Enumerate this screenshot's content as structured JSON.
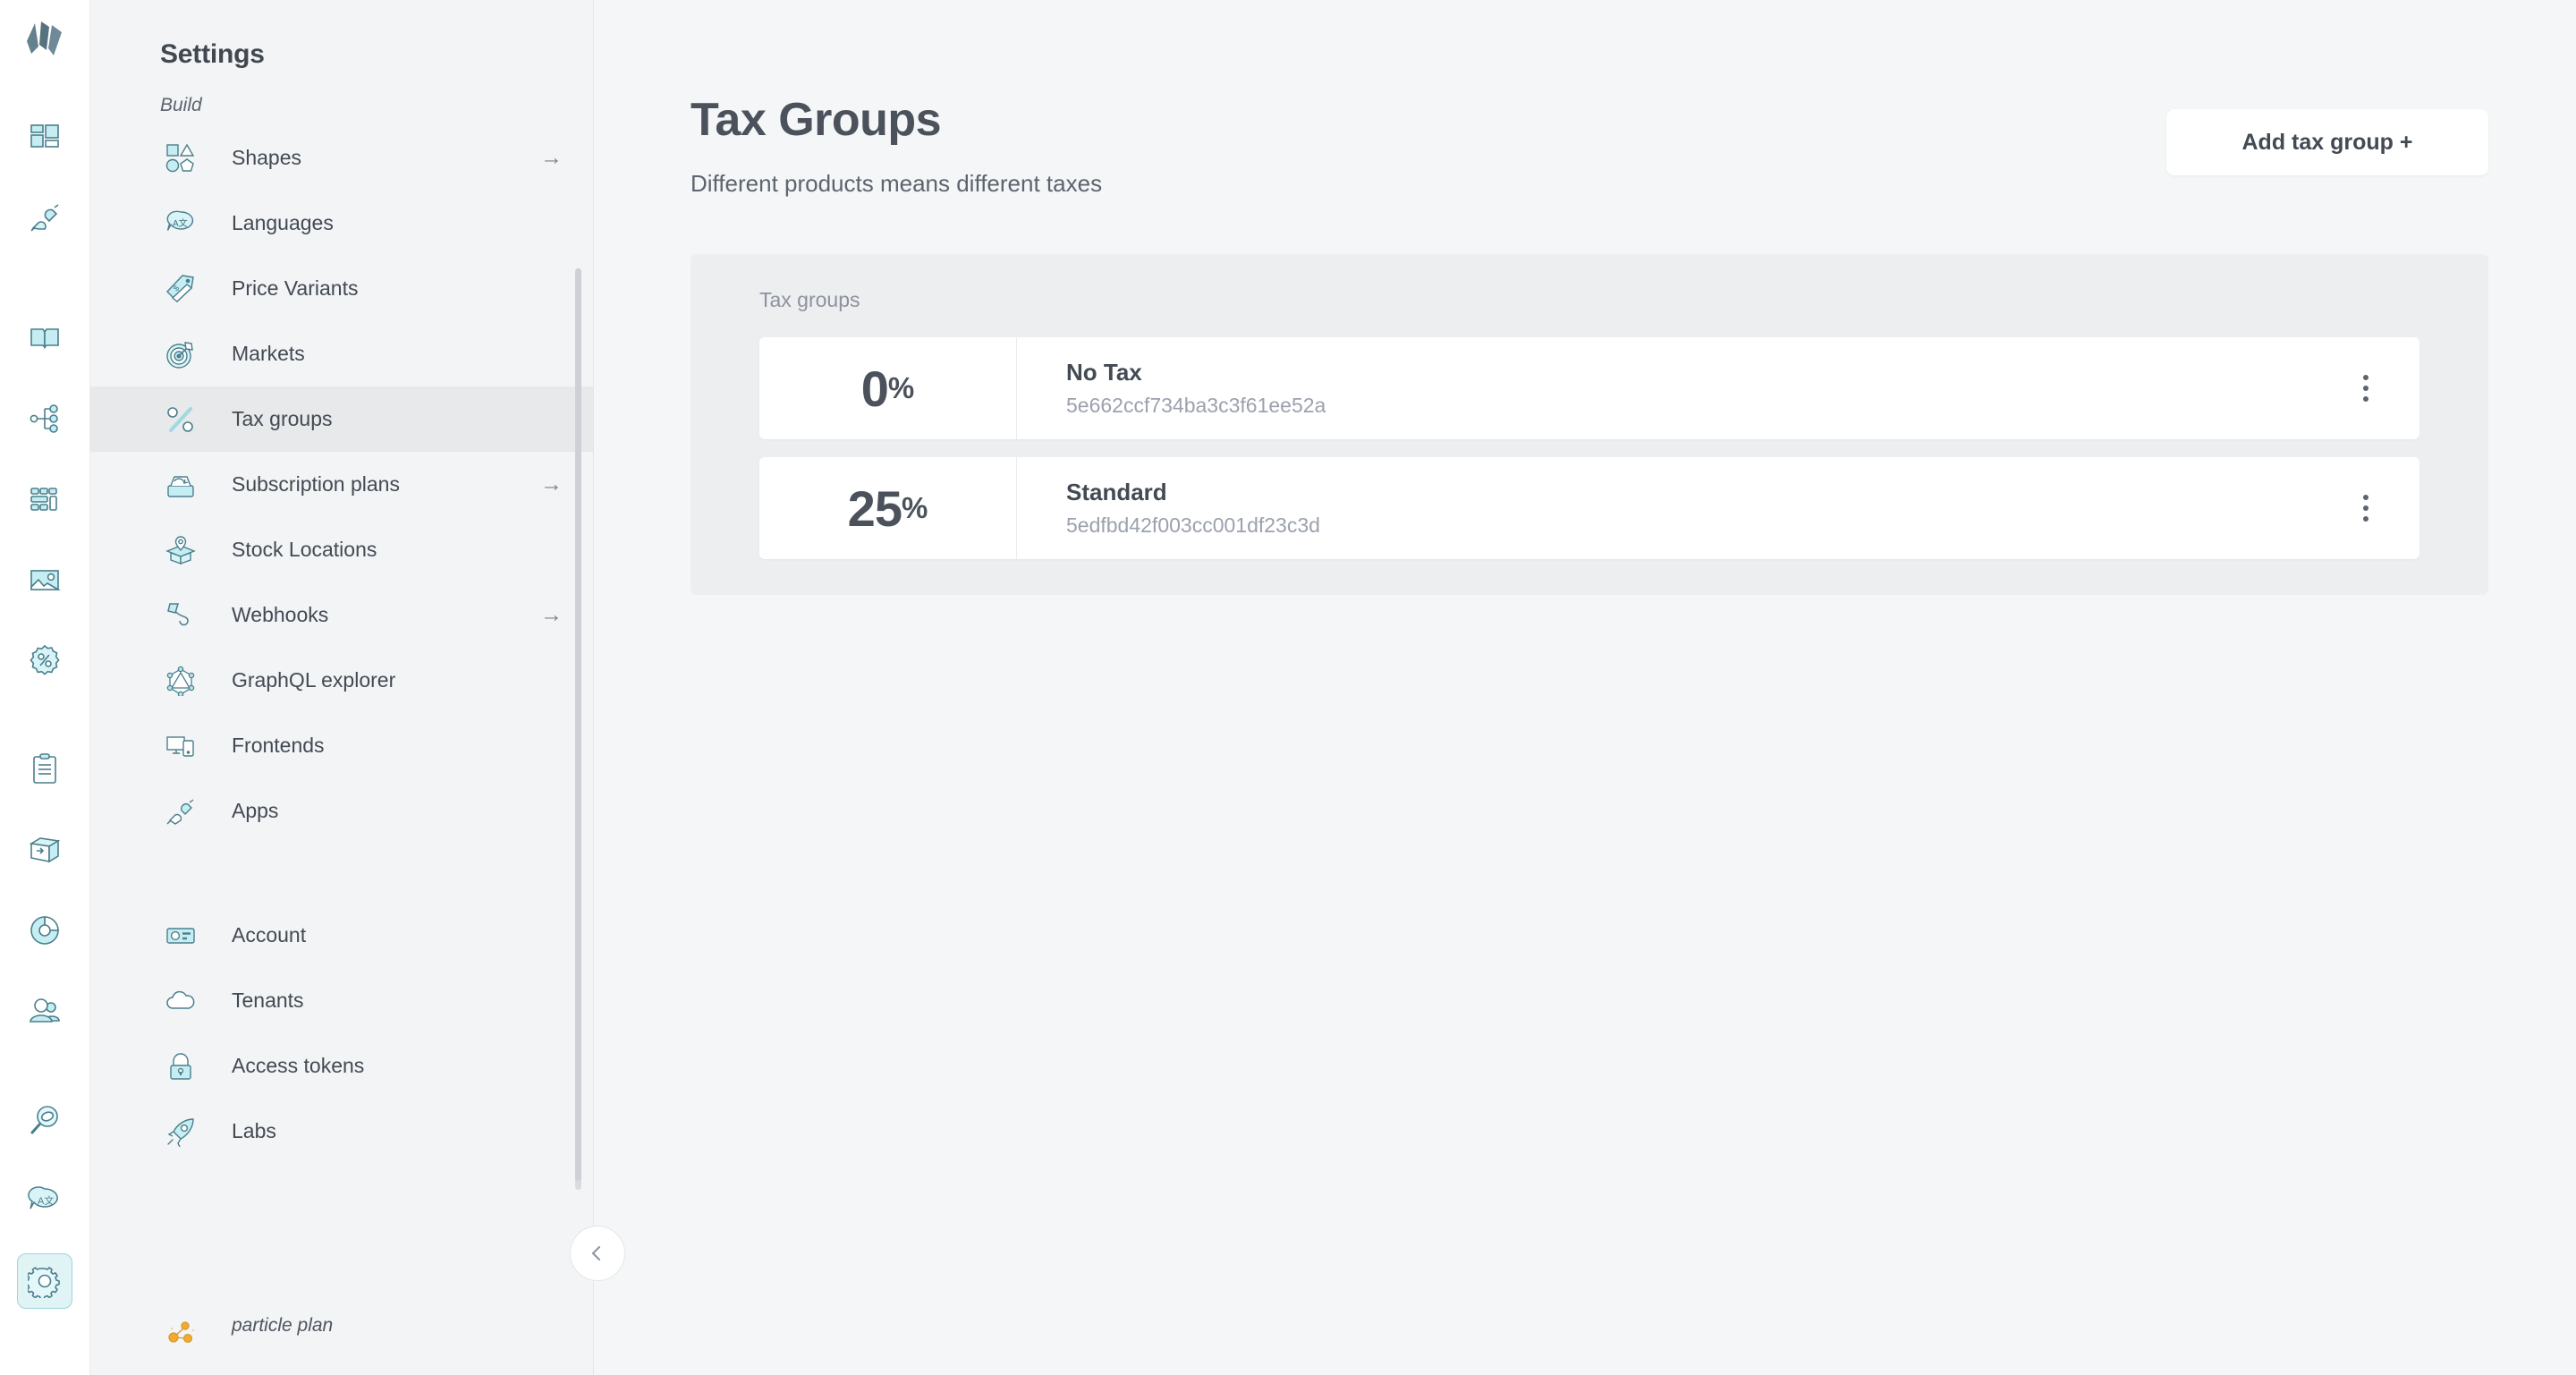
{
  "rail": {
    "logo_name": "crystallize-logo",
    "items": [
      {
        "name": "catalogue-icon"
      },
      {
        "name": "apps-plug-icon"
      },
      {
        "name": "stories-book-icon"
      },
      {
        "name": "topics-tree-icon"
      },
      {
        "name": "grids-icon"
      },
      {
        "name": "images-icon"
      },
      {
        "name": "discounts-icon"
      },
      {
        "name": "orders-clipboard-icon"
      },
      {
        "name": "shipments-box-icon"
      },
      {
        "name": "analytics-pie-icon"
      },
      {
        "name": "customers-icon"
      },
      {
        "name": "search-icon"
      },
      {
        "name": "translations-icon"
      },
      {
        "name": "settings-gear-icon"
      }
    ]
  },
  "sidebar": {
    "title": "Settings",
    "section_label": "Build",
    "build_items": [
      {
        "label": "Shapes",
        "icon": "shapes-icon",
        "arrow": "→"
      },
      {
        "label": "Languages",
        "icon": "languages-icon",
        "arrow": ""
      },
      {
        "label": "Price Variants",
        "icon": "price-tag-icon",
        "arrow": ""
      },
      {
        "label": "Markets",
        "icon": "target-icon",
        "arrow": ""
      },
      {
        "label": "Tax groups",
        "icon": "percent-icon",
        "arrow": "",
        "selected": true
      },
      {
        "label": "Subscription plans",
        "icon": "subscription-icon",
        "arrow": "→"
      },
      {
        "label": "Stock Locations",
        "icon": "stock-location-icon",
        "arrow": ""
      },
      {
        "label": "Webhooks",
        "icon": "webhook-icon",
        "arrow": "→"
      },
      {
        "label": "GraphQL explorer",
        "icon": "graphql-icon",
        "arrow": ""
      },
      {
        "label": "Frontends",
        "icon": "frontends-icon",
        "arrow": ""
      },
      {
        "label": "Apps",
        "icon": "apps-plug-icon",
        "arrow": ""
      }
    ],
    "account_items": [
      {
        "label": "Account",
        "icon": "account-card-icon"
      },
      {
        "label": "Tenants",
        "icon": "cloud-icon"
      },
      {
        "label": "Access tokens",
        "icon": "lock-icon"
      },
      {
        "label": "Labs",
        "icon": "rocket-icon"
      }
    ],
    "plan": {
      "icon": "particles-icon",
      "tenant_redacted": "",
      "plan_name": "particle plan"
    },
    "collapse_icon": "chevron-left-icon"
  },
  "main": {
    "title": "Tax Groups",
    "subtitle": "Different products means different taxes",
    "add_button": "Add tax group +",
    "panel_label": "Tax groups",
    "tax_groups": [
      {
        "rate": "0",
        "percent": "%",
        "name": "No Tax",
        "id": "5e662ccf734ba3c3f61ee52a"
      },
      {
        "rate": "25",
        "percent": "%",
        "name": "Standard",
        "id": "5edfbd42f003cc001df23c3d"
      }
    ]
  },
  "colors": {
    "accent": "#b6e6ec",
    "icon_stroke": "#4a7f8c",
    "sidebar_bg": "#f2f4f5",
    "main_bg": "#f4f6f7",
    "selected_bg": "#e7e9ea",
    "text": "#434a54"
  }
}
